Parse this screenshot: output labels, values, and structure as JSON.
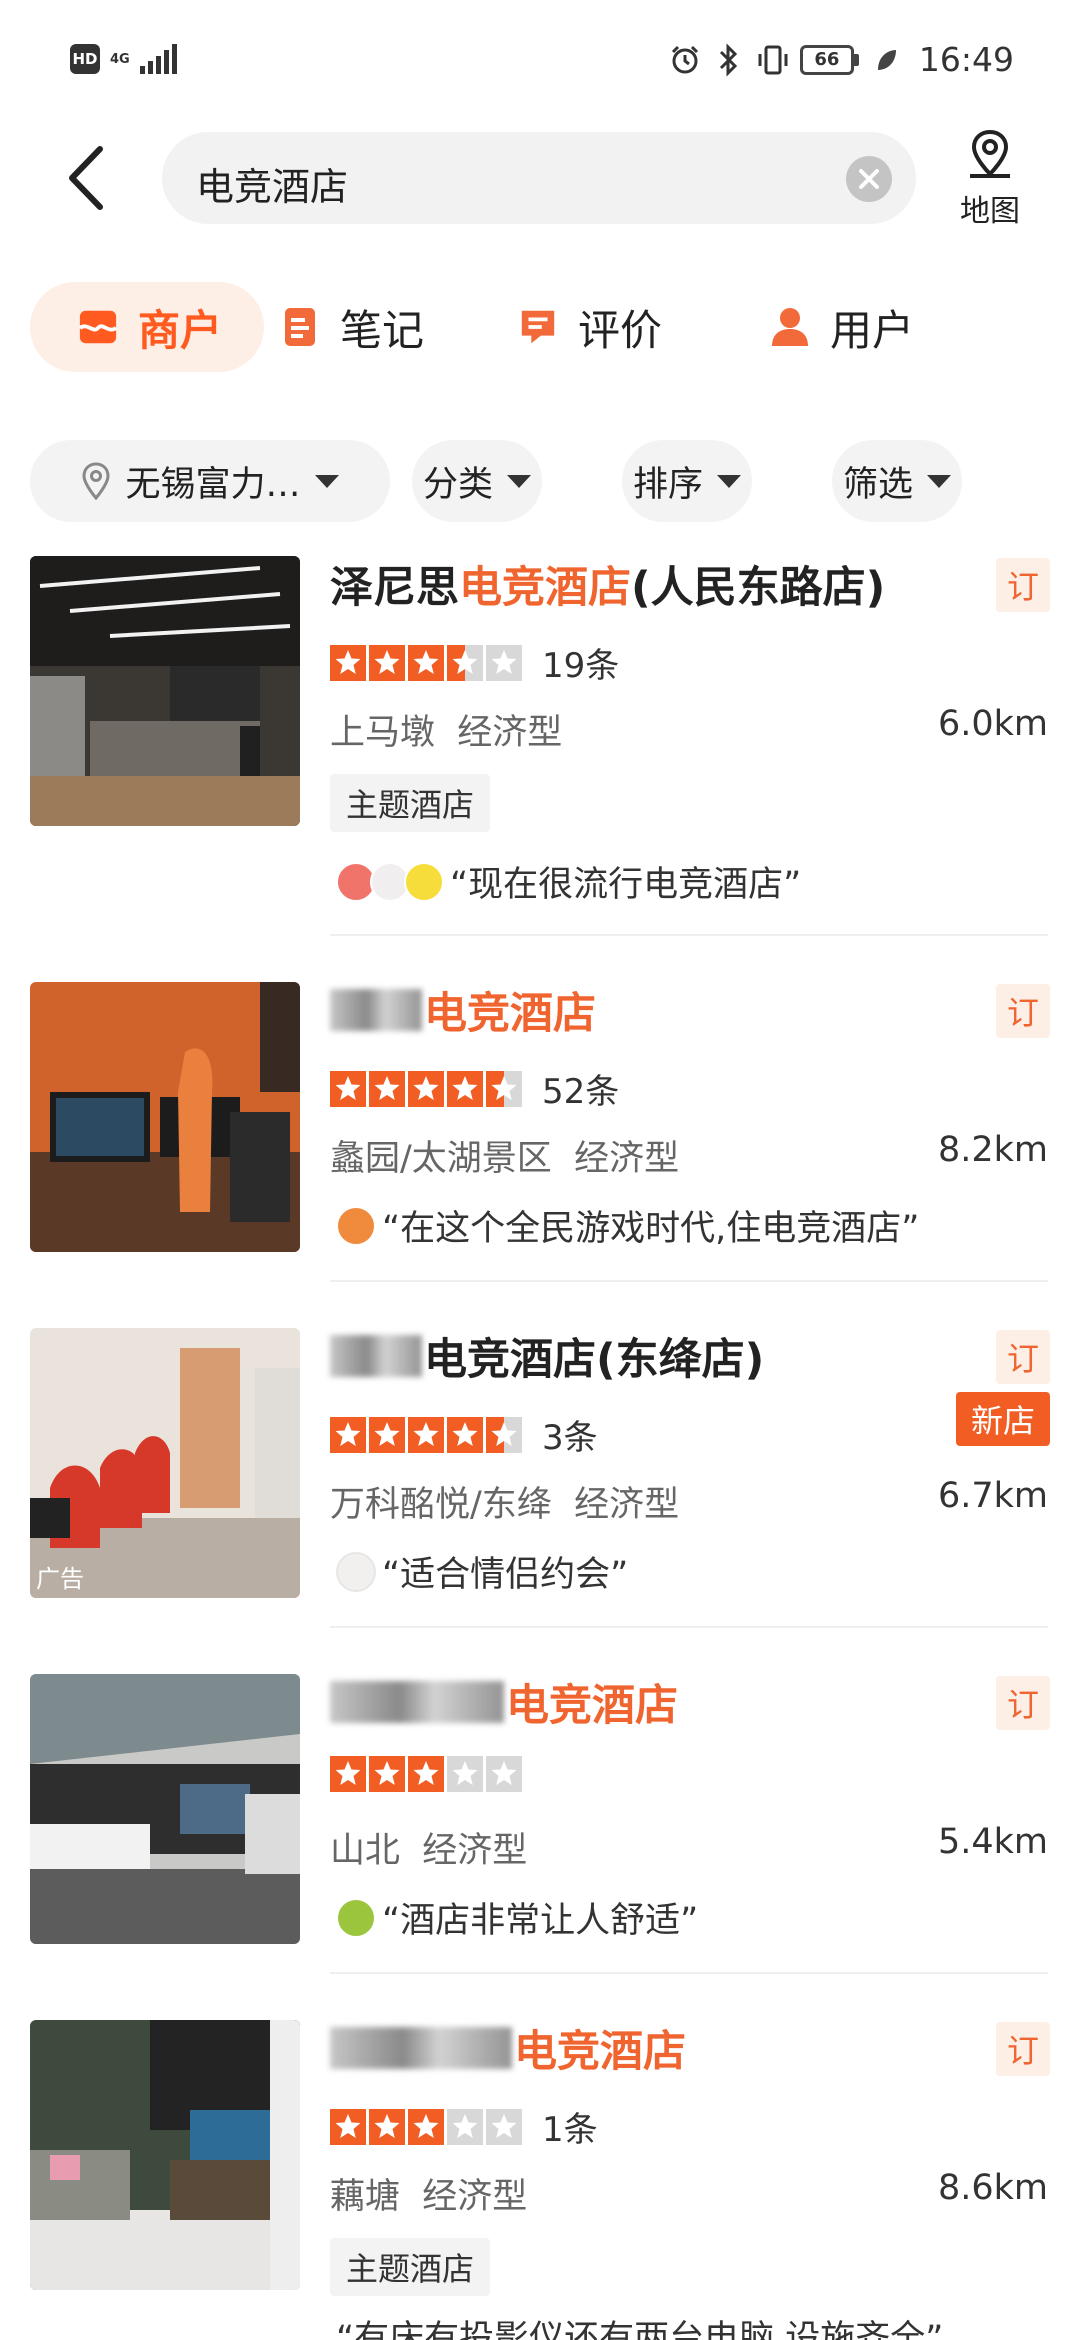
{
  "status_bar": {
    "hd": "HD",
    "network": "4G",
    "battery": "66",
    "time": "16:49"
  },
  "search": {
    "query": "电竞酒店",
    "map_label": "地图"
  },
  "tabs": [
    {
      "label": "商户",
      "icon": "shop-icon",
      "active": true
    },
    {
      "label": "笔记",
      "icon": "note-icon",
      "active": false
    },
    {
      "label": "评价",
      "icon": "review-icon",
      "active": false
    },
    {
      "label": "用户",
      "icon": "user-icon",
      "active": false
    }
  ],
  "filters": [
    {
      "label": "无锡富力…",
      "icon": "location-pin-icon"
    },
    {
      "label": "分类"
    },
    {
      "label": "排序"
    },
    {
      "label": "筛选"
    }
  ],
  "listings": [
    {
      "title_prefix": "泽尼思",
      "title_highlight": "电竞酒店",
      "title_suffix": "(人民东路店)",
      "book_label": "订",
      "stars": 3.5,
      "reviews": "19条",
      "area": "上马墩",
      "category": "经济型",
      "distance": "6.0km",
      "tag": "主题酒店",
      "quote": "“现在很流行电竞酒店”"
    },
    {
      "title_highlight": "电竞酒店",
      "book_label": "订",
      "stars": 4.5,
      "reviews": "52条",
      "area": "蠡园/太湖景区",
      "category": "经济型",
      "distance": "8.2km",
      "quote": "“在这个全民游戏时代,住电竞酒店”"
    },
    {
      "title_suffix": "电竞酒店(东绛店)",
      "book_label": "订",
      "new_label": "新店",
      "stars": 4.5,
      "reviews": "3条",
      "area": "万科酩悦/东绛",
      "category": "经济型",
      "distance": "6.7km",
      "quote": "“适合情侣约会”",
      "ad_label": "广告"
    },
    {
      "title_highlight": "电竞酒店",
      "book_label": "订",
      "stars": 3,
      "area": "山北",
      "category": "经济型",
      "distance": "5.4km",
      "quote": "“酒店非常让人舒适”"
    },
    {
      "title_highlight": "电竞酒店",
      "book_label": "订",
      "stars": 3,
      "reviews": "1条",
      "area": "藕塘",
      "category": "经济型",
      "distance": "8.6km",
      "tag": "主题酒店",
      "quote": "“有床有投影仪还有两台电脑,设施齐全”"
    }
  ],
  "colors": {
    "accent": "#f0642f",
    "accent_bg": "#fdeee6",
    "star": "#f25d23",
    "star_empty": "#d8d8d8"
  }
}
